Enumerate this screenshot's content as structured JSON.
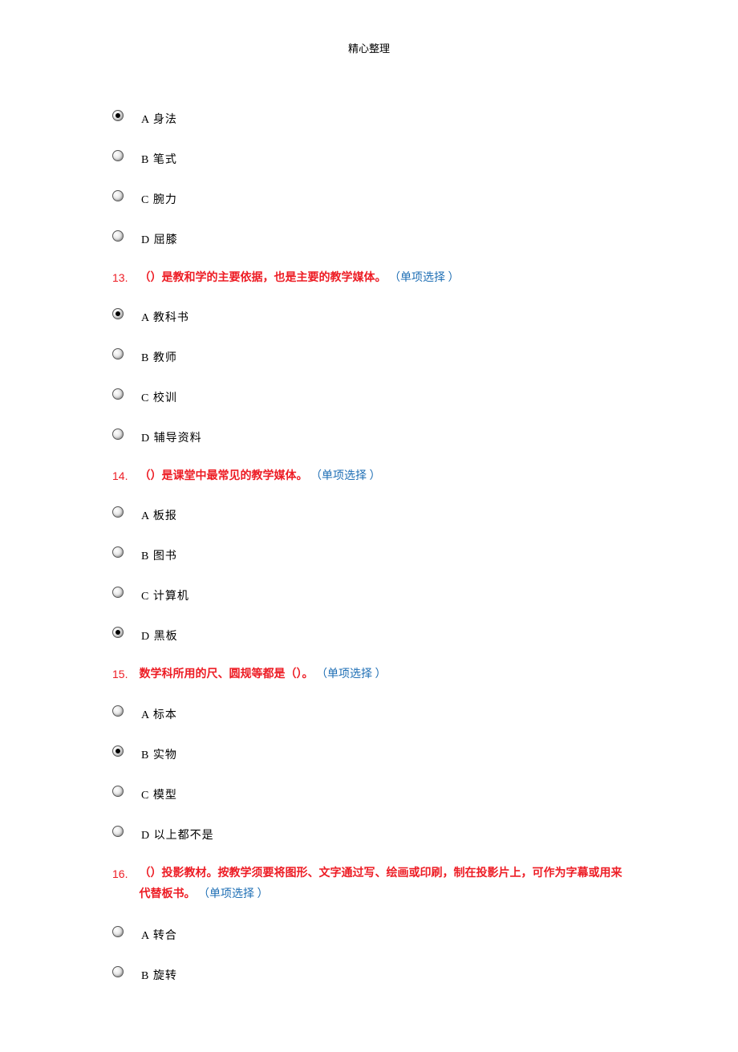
{
  "header": "精心整理",
  "questions": [
    {
      "num": "12_partial",
      "options": [
        {
          "label": "A 身法",
          "selected": true
        },
        {
          "label": "B 笔式",
          "selected": false
        },
        {
          "label": "C 腕力",
          "selected": false
        },
        {
          "label": "D 屈膝",
          "selected": false
        }
      ]
    },
    {
      "num": "13.",
      "text": "（）是教和学的主要依据，也是主要的教学媒体。",
      "type": "（单项选择 ）",
      "options": [
        {
          "label": "A 教科书",
          "selected": true
        },
        {
          "label": "B 教师",
          "selected": false
        },
        {
          "label": "C 校训",
          "selected": false
        },
        {
          "label": "D 辅导资料",
          "selected": false
        }
      ]
    },
    {
      "num": "14.",
      "text": "（）是课堂中最常见的教学媒体。",
      "type": "（单项选择 ）",
      "options": [
        {
          "label": "A 板报",
          "selected": false
        },
        {
          "label": "B 图书",
          "selected": false
        },
        {
          "label": "C 计算机",
          "selected": false
        },
        {
          "label": "D 黑板",
          "selected": true
        }
      ]
    },
    {
      "num": "15.",
      "text": "数学科所用的尺、圆规等都是（）。",
      "type": "（单项选择 ）",
      "options": [
        {
          "label": "A 标本",
          "selected": false
        },
        {
          "label": "B 实物",
          "selected": true
        },
        {
          "label": "C 模型",
          "selected": false
        },
        {
          "label": "D 以上都不是",
          "selected": false
        }
      ]
    },
    {
      "num": "16.",
      "text": "（）投影教材。按教学须要将图形、文字通过写、绘画或印刷，制在投影片上，可作为字幕或用来代替板书。",
      "type": "（单项选择 ）",
      "options": [
        {
          "label": "A 转合",
          "selected": false
        },
        {
          "label": "B 旋转",
          "selected": false
        }
      ]
    }
  ]
}
